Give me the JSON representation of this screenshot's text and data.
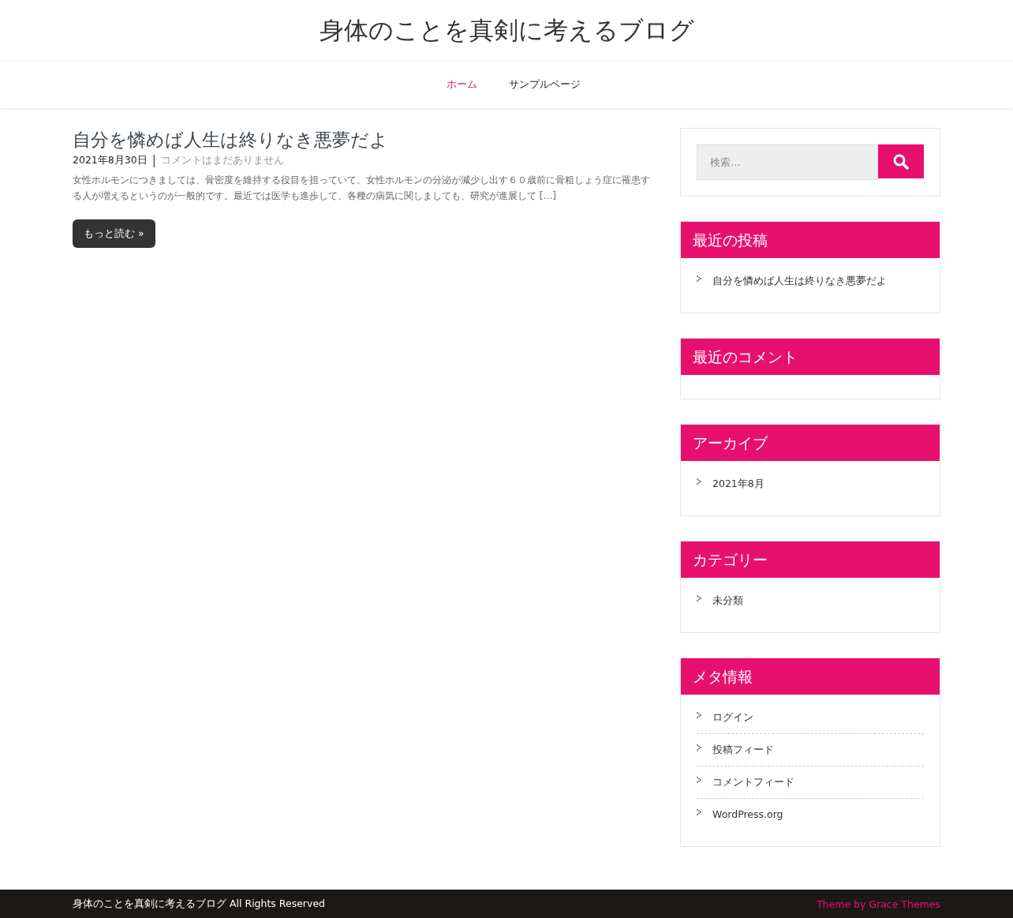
{
  "site_title": "身体のことを真剣に考えるブログ",
  "nav": [
    {
      "label": "ホーム",
      "selected": true
    },
    {
      "label": "サンプルページ",
      "selected": false
    }
  ],
  "post": {
    "title": "自分を憐めば人生は終りなき悪夢だよ",
    "date": "2021年8月30日",
    "separator": "|",
    "comments": "コメントはまだありません",
    "excerpt": "女性ホルモンにつきましては、骨密度を維持する役目を担っていて、女性ホルモンの分泌が減少し出す６０歳前に骨粗しょう症に罹患する人が増えるというのが一般的です。最近では医学も進歩して、各種の病気に関しましても、研究が進展して […]",
    "read_more": "もっと読む »"
  },
  "sidebar": {
    "search": {
      "placeholder": "検索…"
    },
    "widgets": [
      {
        "title": "最近の投稿",
        "items": [
          "自分を憐めば人生は終りなき悪夢だよ"
        ]
      },
      {
        "title": "最近のコメント"
      },
      {
        "title": "アーカイブ",
        "items": [
          "2021年8月"
        ]
      },
      {
        "title": "カテゴリー",
        "items": [
          "未分類"
        ]
      },
      {
        "title": "メタ情報",
        "items": [
          "ログイン",
          "投稿フィード",
          "コメントフィード",
          "WordPress.org"
        ]
      }
    ]
  },
  "footer": {
    "copyright": "身体のことを真剣に考えるブログ All Rights Reserved",
    "credit": "Theme by Grace Themes"
  }
}
